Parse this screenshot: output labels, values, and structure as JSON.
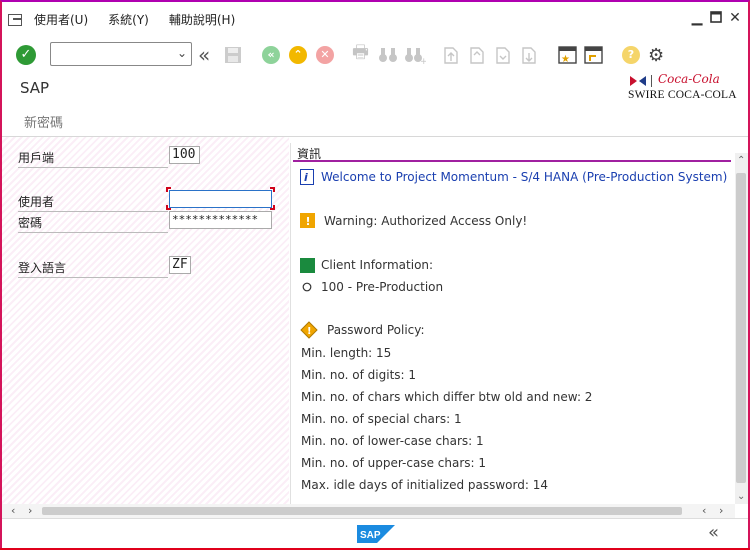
{
  "menubar": {
    "items": [
      {
        "label": "使用者(U)"
      },
      {
        "label": "系統(Y)"
      },
      {
        "label": "輔助說明(H)"
      }
    ],
    "controls": [
      "minimize-icon",
      "maximize-icon",
      "close-icon"
    ]
  },
  "toolbar": {
    "command_field": {
      "value": "",
      "placeholder": ""
    },
    "icons": [
      "enter-icon",
      "back-double-icon",
      "save-icon",
      "back-icon",
      "exit-icon",
      "cancel-icon",
      "print-icon",
      "find-icon",
      "find-next-icon",
      "first-page-icon",
      "prev-page-icon",
      "next-page-icon",
      "last-page-icon",
      "new-session-icon",
      "shortcut-icon",
      "help-icon",
      "settings-icon"
    ]
  },
  "header": {
    "title": "SAP",
    "subtitle": "新密碼",
    "logo_text": "Coca-Cola",
    "logo_sub": "SWIRE COCA-COLA"
  },
  "form": {
    "client": {
      "label": "用戶端",
      "value": "100"
    },
    "user": {
      "label": "使用者",
      "value": ""
    },
    "password": {
      "label": "密碼",
      "value": "*************"
    },
    "language": {
      "label": "登入語言",
      "value": "ZF"
    }
  },
  "info": {
    "heading": "資訊",
    "welcome": "Welcome to Project Momentum - S/4 HANA (Pre-Production System)",
    "warning": "Warning:  Authorized Access Only!",
    "client_info": "Client Information:",
    "client_value": "100 - Pre-Production",
    "policy_title": "Password Policy:",
    "policy": [
      "Min. length: 15",
      "Min. no. of digits: 1",
      "Min. no. of chars which differ btw old and new: 2",
      "Min. no. of special chars: 1",
      "Min. no. of lower-case chars: 1",
      "Min. no. of upper-case chars: 1",
      "Max. idle days of initialized password: 14"
    ]
  },
  "colors": {
    "accent_purple": "#a020a0",
    "check_green": "#2e9a35",
    "info_blue": "#1a3fb0",
    "warning_orange": "#f0a500"
  }
}
